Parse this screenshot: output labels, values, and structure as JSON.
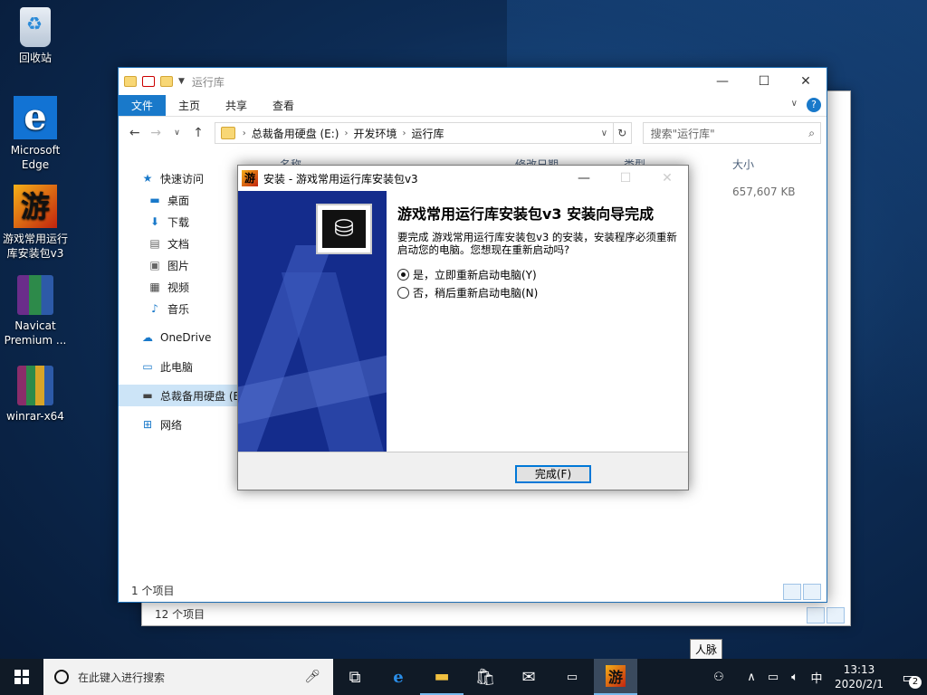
{
  "desktop": {
    "icons": [
      {
        "label": "回收站"
      },
      {
        "label": "Microsoft Edge"
      },
      {
        "label": "游戏常用运行库安装包v3"
      },
      {
        "label": "Navicat Premium ..."
      },
      {
        "label": "winrar-x64"
      }
    ]
  },
  "explorer_back": {
    "status": "12 个项目"
  },
  "explorer": {
    "title": "运行库",
    "ribbon_tabs": [
      "文件",
      "主页",
      "共享",
      "查看"
    ],
    "breadcrumb": [
      "总裁备用硬盘 (E:)",
      "开发环境",
      "运行库"
    ],
    "search_placeholder": "搜索\"运行库\"",
    "columns": [
      "名称",
      "修改日期",
      "类型",
      "大小"
    ],
    "file_size": "657,607 KB",
    "nav": [
      "快速访问",
      "桌面",
      "下载",
      "文档",
      "图片",
      "视频",
      "音乐",
      "OneDrive",
      "此电脑",
      "总裁备用硬盘 (E:)",
      "网络"
    ],
    "status": "1 个项目"
  },
  "installer": {
    "title": "安装 - 游戏常用运行库安装包v3",
    "heading": "游戏常用运行库安装包v3 安装向导完成",
    "message": "要完成 游戏常用运行库安装包v3 的安装，安装程序必须重新启动您的电脑。您想现在重新启动吗?",
    "option_yes": "是，立即重新启动电脑(Y)",
    "option_no": "否，稍后重新启动电脑(N)",
    "selected": "yes",
    "finish_label": "完成(F)"
  },
  "tooltip": "人脉",
  "taskbar": {
    "search_placeholder": "在此键入进行搜索",
    "ime": "中",
    "time": "13:13",
    "date": "2020/2/1",
    "notification_count": "2"
  },
  "colors": {
    "accent": "#1979ca",
    "taskbar": "#101a26",
    "banner": "#142c8c"
  }
}
